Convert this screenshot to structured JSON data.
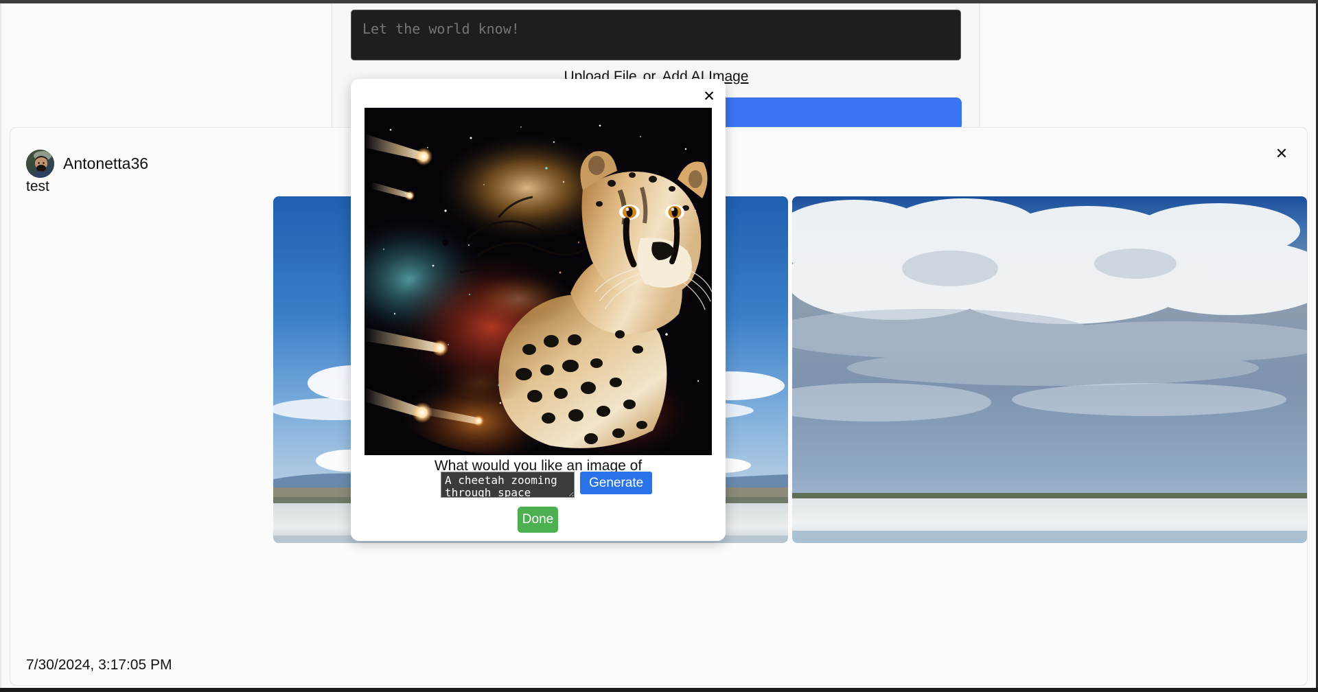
{
  "composer": {
    "placeholder": "Let the world know!",
    "upload_label": "Upload File",
    "or_label": "or",
    "ai_label": "Add AI Image",
    "primary_button_label": "",
    "secondary_button_label": "",
    "accent_color": "#3b74f2"
  },
  "post": {
    "username": "Antonetta36",
    "body": "test",
    "timestamp": "7/30/2024, 3:17:05 PM",
    "close_icon": "✕",
    "avatar_icon": "user-photo"
  },
  "modal": {
    "close_icon": "✕",
    "prompt_label": "What would you like an image of",
    "prompt_value": "A cheetah zooming through space",
    "prompt_placeholder": "",
    "generate_label": "Generate",
    "done_label": "Done",
    "generate_color": "#2a72e8",
    "done_color": "#4caf50",
    "image_alt": "cheetah-in-space-ai-image"
  },
  "photos": [
    {
      "alt": "salt-flat-blue-sky-photo"
    },
    {
      "alt": "salt-flat-cloudy-sky-photo"
    }
  ]
}
